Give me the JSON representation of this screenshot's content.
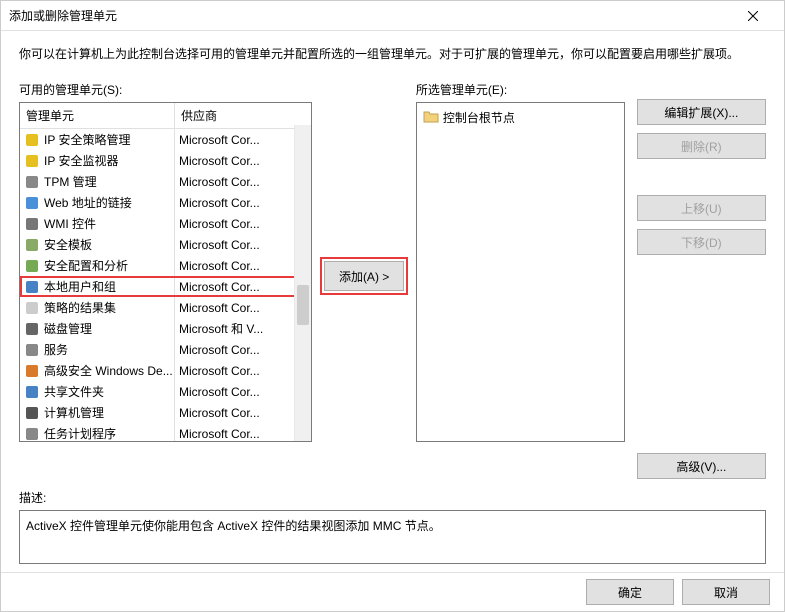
{
  "titlebar": {
    "title": "添加或删除管理单元"
  },
  "intro": "你可以在计算机上为此控制台选择可用的管理单元并配置所选的一组管理单元。对于可扩展的管理单元，你可以配置要启用哪些扩展项。",
  "available": {
    "label": "可用的管理单元(S):",
    "columns": {
      "snapin": "管理单元",
      "vendor": "供应商"
    },
    "rows": [
      {
        "name": "IP 安全策略管理",
        "vendor": "Microsoft Cor...",
        "icon": "shield-yellow"
      },
      {
        "name": "IP 安全监视器",
        "vendor": "Microsoft Cor...",
        "icon": "shield-yellow"
      },
      {
        "name": "TPM 管理",
        "vendor": "Microsoft Cor...",
        "icon": "chip"
      },
      {
        "name": "Web 地址的链接",
        "vendor": "Microsoft Cor...",
        "icon": "link"
      },
      {
        "name": "WMI 控件",
        "vendor": "Microsoft Cor...",
        "icon": "gear-doc"
      },
      {
        "name": "安全模板",
        "vendor": "Microsoft Cor...",
        "icon": "lock-doc"
      },
      {
        "name": "安全配置和分析",
        "vendor": "Microsoft Cor...",
        "icon": "lock-check"
      },
      {
        "name": "本地用户和组",
        "vendor": "Microsoft Cor...",
        "icon": "users",
        "highlighted": true
      },
      {
        "name": "策略的结果集",
        "vendor": "Microsoft Cor...",
        "icon": "doc"
      },
      {
        "name": "磁盘管理",
        "vendor": "Microsoft 和 V...",
        "icon": "disk"
      },
      {
        "name": "服务",
        "vendor": "Microsoft Cor...",
        "icon": "gears"
      },
      {
        "name": "高级安全 Windows De...",
        "vendor": "Microsoft Cor...",
        "icon": "firewall"
      },
      {
        "name": "共享文件夹",
        "vendor": "Microsoft Cor...",
        "icon": "share"
      },
      {
        "name": "计算机管理",
        "vendor": "Microsoft Cor...",
        "icon": "pc"
      },
      {
        "name": "任务计划程序",
        "vendor": "Microsoft Cor...",
        "icon": "clock"
      }
    ]
  },
  "selected": {
    "label": "所选管理单元(E):",
    "root": "控制台根节点"
  },
  "buttons": {
    "add": "添加(A) >",
    "edit_ext": "编辑扩展(X)...",
    "remove": "删除(R)",
    "move_up": "上移(U)",
    "move_down": "下移(D)",
    "advanced": "高级(V)..."
  },
  "description": {
    "label": "描述:",
    "text": "ActiveX 控件管理单元使你能用包含 ActiveX 控件的结果视图添加 MMC 节点。"
  },
  "footer": {
    "ok": "确定",
    "cancel": "取消"
  }
}
